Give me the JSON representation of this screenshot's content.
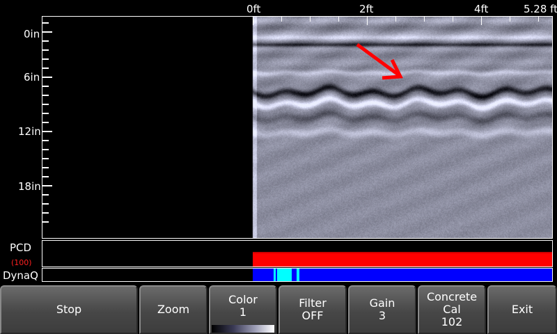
{
  "top_axis": {
    "labels": [
      "0ft",
      "2ft",
      "4ft",
      "5.28 ft"
    ]
  },
  "left_axis": {
    "labels": [
      "0in",
      "6in",
      "12in",
      "18in"
    ]
  },
  "channels": {
    "pcd_label": "PCD",
    "pcd_value": "(100)",
    "dynaq_label": "DynaQ"
  },
  "colors": {
    "pcd_bar": "#ff0000",
    "dynaq_bar": "#0000ff",
    "dynaq_highlight": "#00ffff",
    "arrow": "#ff0000"
  },
  "toolbar": {
    "stop": "Stop",
    "zoom": "Zoom",
    "color_label": "Color",
    "color_value": "1",
    "filter_label": "Filter",
    "filter_value": "OFF",
    "gain_label": "Gain",
    "gain_value": "3",
    "cal_label_1": "Concrete",
    "cal_label_2": "Cal",
    "cal_value": "102",
    "exit": "Exit"
  }
}
